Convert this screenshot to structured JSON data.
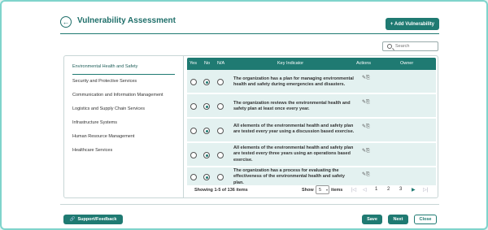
{
  "header": {
    "back_icon": "arrow-left-icon",
    "title": "Vulnerability Assessment",
    "add_button": "+ Add Vulnerability"
  },
  "search": {
    "placeholder": "Search",
    "icon": "search-icon"
  },
  "sidebar": {
    "items": [
      {
        "label": "Environmental Health and Safety",
        "active": true
      },
      {
        "label": "Security and Protective Services",
        "active": false
      },
      {
        "label": "Communication and Information Management",
        "active": false
      },
      {
        "label": "Logistics and Supply Chain Services",
        "active": false
      },
      {
        "label": "Infrastructure Systems",
        "active": false
      },
      {
        "label": "Human Resource Management",
        "active": false
      },
      {
        "label": "Healthcare Services",
        "active": false
      }
    ]
  },
  "table": {
    "columns": {
      "yes": "Yes",
      "no": "No",
      "na": "N/A",
      "indicator": "Key Indicator",
      "actions": "Actions",
      "owner": "Owner"
    },
    "rows": [
      {
        "indicator": "The organization has a plan for managing environmental health and safety during emergencies and disasters.",
        "selected": "No",
        "actions": "✎⎘"
      },
      {
        "indicator": "The organization reviews the environmental health and safety plan at least once every year.",
        "selected": "No",
        "actions": "✎⎘"
      },
      {
        "indicator": "All elements of the environmental health and safety plan are tested every year using a discussion based exercise.",
        "selected": "No",
        "actions": "✎⎘"
      },
      {
        "indicator": "All elements of the environmental health and safety plan are tested every three years using an operations based exercise.",
        "selected": "No",
        "actions": "✎⎘"
      },
      {
        "indicator": "The organization has a process for evaluating the effectiveness of the environmental health and safety plan.",
        "selected": "No",
        "actions": "✎⎘"
      }
    ]
  },
  "pager": {
    "summary": "Showing 1-5 of 136 items",
    "show_label": "Show",
    "page_size": "5",
    "items_label": "items",
    "first": "|◁",
    "prev": "◁",
    "pages": [
      "1",
      "2",
      "3"
    ],
    "next": "▶",
    "last": "▷|"
  },
  "footer": {
    "support": "Support/Feedback",
    "save": "Save",
    "next": "Next",
    "close": "Close"
  },
  "colors": {
    "accent": "#1f7a72",
    "row_bg": "#e3f1f0",
    "frame": "#7fd4cc"
  }
}
